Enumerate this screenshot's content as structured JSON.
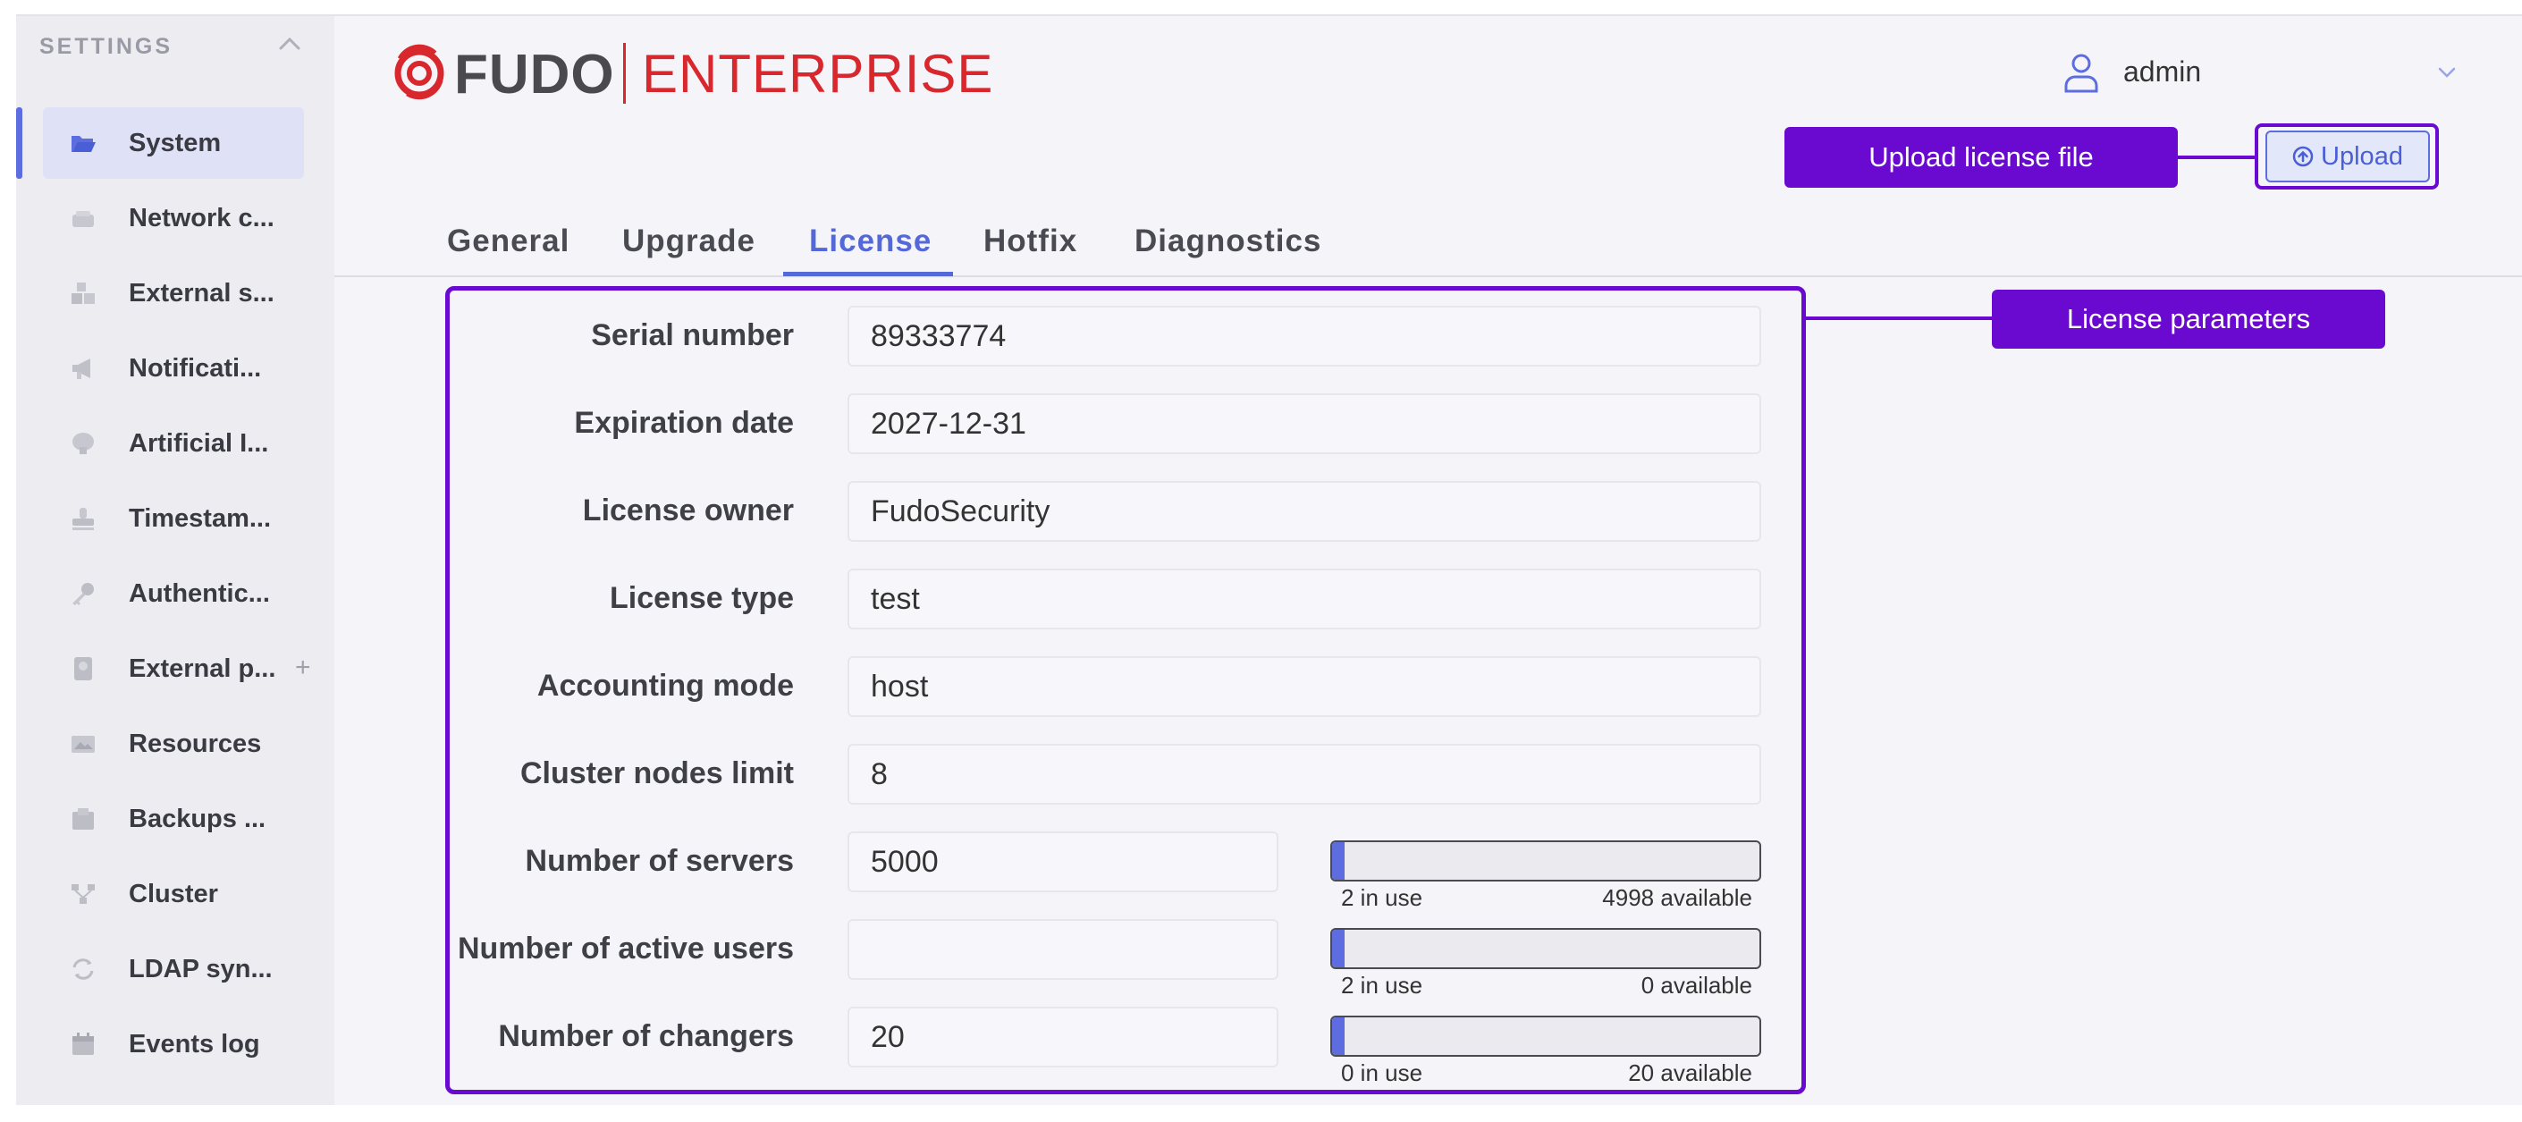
{
  "sidebar": {
    "header": "SETTINGS",
    "items": [
      {
        "label": "System",
        "icon": "folder-open-icon",
        "active": true
      },
      {
        "label": "Network c...",
        "icon": "network-icon"
      },
      {
        "label": "External s...",
        "icon": "boxes-icon"
      },
      {
        "label": "Notificati...",
        "icon": "megaphone-icon"
      },
      {
        "label": "Artificial I...",
        "icon": "brain-icon"
      },
      {
        "label": "Timestam...",
        "icon": "stamp-icon"
      },
      {
        "label": "Authentic...",
        "icon": "key-icon"
      },
      {
        "label": "External p...",
        "icon": "passport-icon"
      },
      {
        "label": "Resources",
        "icon": "image-icon"
      },
      {
        "label": "Backups ...",
        "icon": "archive-icon"
      },
      {
        "label": "Cluster",
        "icon": "cluster-icon"
      },
      {
        "label": "LDAP syn...",
        "icon": "sync-icon"
      },
      {
        "label": "Events log",
        "icon": "calendar-icon"
      }
    ]
  },
  "header": {
    "logo_fudo": "FUDO",
    "logo_enterprise": "ENTERPRISE",
    "user": "admin"
  },
  "annotations": {
    "upload": "Upload license file",
    "params": "License parameters"
  },
  "upload_button": "Upload",
  "tabs": [
    {
      "label": "General"
    },
    {
      "label": "Upgrade"
    },
    {
      "label": "License",
      "active": true
    },
    {
      "label": "Hotfix"
    },
    {
      "label": "Diagnostics"
    }
  ],
  "license": {
    "serial_number": {
      "label": "Serial number",
      "value": "89333774"
    },
    "expiration_date": {
      "label": "Expiration date",
      "value": "2027-12-31"
    },
    "license_owner": {
      "label": "License owner",
      "value": "FudoSecurity"
    },
    "license_type": {
      "label": "License type",
      "value": "test"
    },
    "accounting_mode": {
      "label": "Accounting mode",
      "value": "host"
    },
    "cluster_nodes_limit": {
      "label": "Cluster nodes limit",
      "value": "8"
    },
    "servers": {
      "label": "Number of servers",
      "value": "5000",
      "in_use": "2 in use",
      "available": "4998 available",
      "usage_fraction": 0.03
    },
    "active_users": {
      "label": "Number of active users",
      "value": "",
      "in_use": "2 in use",
      "available": "0 available",
      "usage_fraction": 0.03
    },
    "changers": {
      "label": "Number of changers",
      "value": "20",
      "in_use": "0 in use",
      "available": "20 available",
      "usage_fraction": 0.03
    }
  },
  "colors": {
    "accent": "#5468d8",
    "annotation": "#6a0ad0",
    "brand_red": "#d9272e"
  }
}
